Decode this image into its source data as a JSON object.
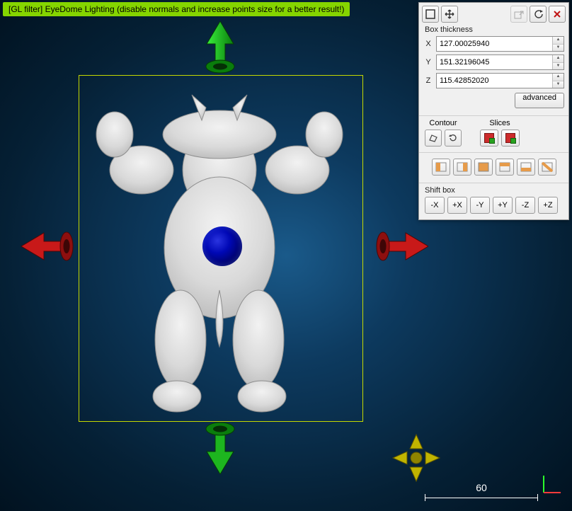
{
  "filter_bar": "[GL filter] EyeDome Lighting (disable normals and increase points size for a better result!)",
  "panel": {
    "box_thickness_label": "Box thickness",
    "x_label": "X",
    "y_label": "Y",
    "z_label": "Z",
    "x_value": "127.00025940",
    "y_value": "151.32196045",
    "z_value": "115.42852020",
    "advanced_label": "advanced",
    "contour_label": "Contour",
    "slices_label": "Slices",
    "shift_box_label": "Shift box",
    "shift_buttons": [
      "-X",
      "+X",
      "-Y",
      "+Y",
      "-Z",
      "+Z"
    ]
  },
  "scale": {
    "value": "60"
  },
  "icons": {
    "restore": "restore-icon",
    "move": "move-icon",
    "export": "export-selection-icon",
    "reset": "reset-icon",
    "close": "close-icon",
    "contour_polyline": "polyline-icon",
    "contour_refresh": "refresh-icon",
    "slice_single": "slice-single-icon",
    "slice_multi": "slice-multi-icon"
  }
}
